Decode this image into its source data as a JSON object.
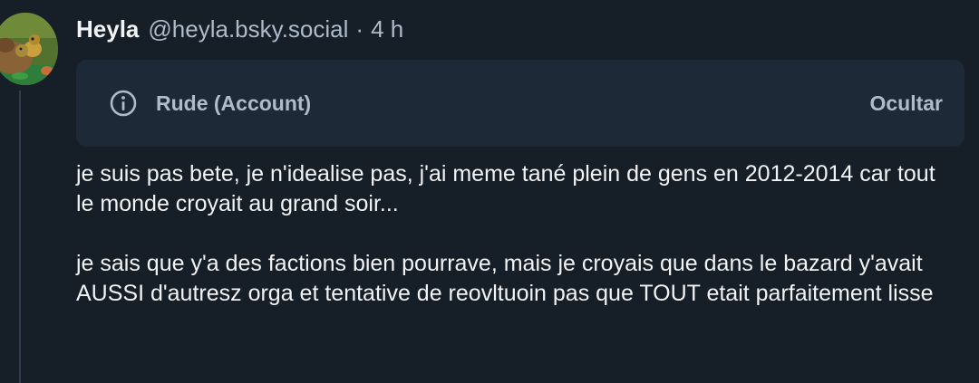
{
  "post": {
    "author": {
      "display_name": "Heyla",
      "handle": "@heyla.bsky.social"
    },
    "separator": "·",
    "time_ago": "4 h",
    "moderation": {
      "icon": "info-circle-icon",
      "label": "Rude (Account)",
      "hide_label": "Ocultar"
    },
    "paragraphs": [
      "je suis pas bete, je n'idealise pas, j'ai meme tané plein de gens en 2012-2014 car tout le monde croyait au grand soir...",
      "je sais que y'a des factions bien pourrave, mais je croyais que dans le bazard y'avait AUSSI d'autresz orga et tentative de reovltuoin pas que TOUT etait parfaitement lisse"
    ]
  },
  "colors": {
    "background": "#161e27",
    "moderation_background": "#1e2937",
    "primary_text": "#f1f3f5",
    "secondary_text": "#aebbc9",
    "thread_line": "#2e3c4d"
  }
}
